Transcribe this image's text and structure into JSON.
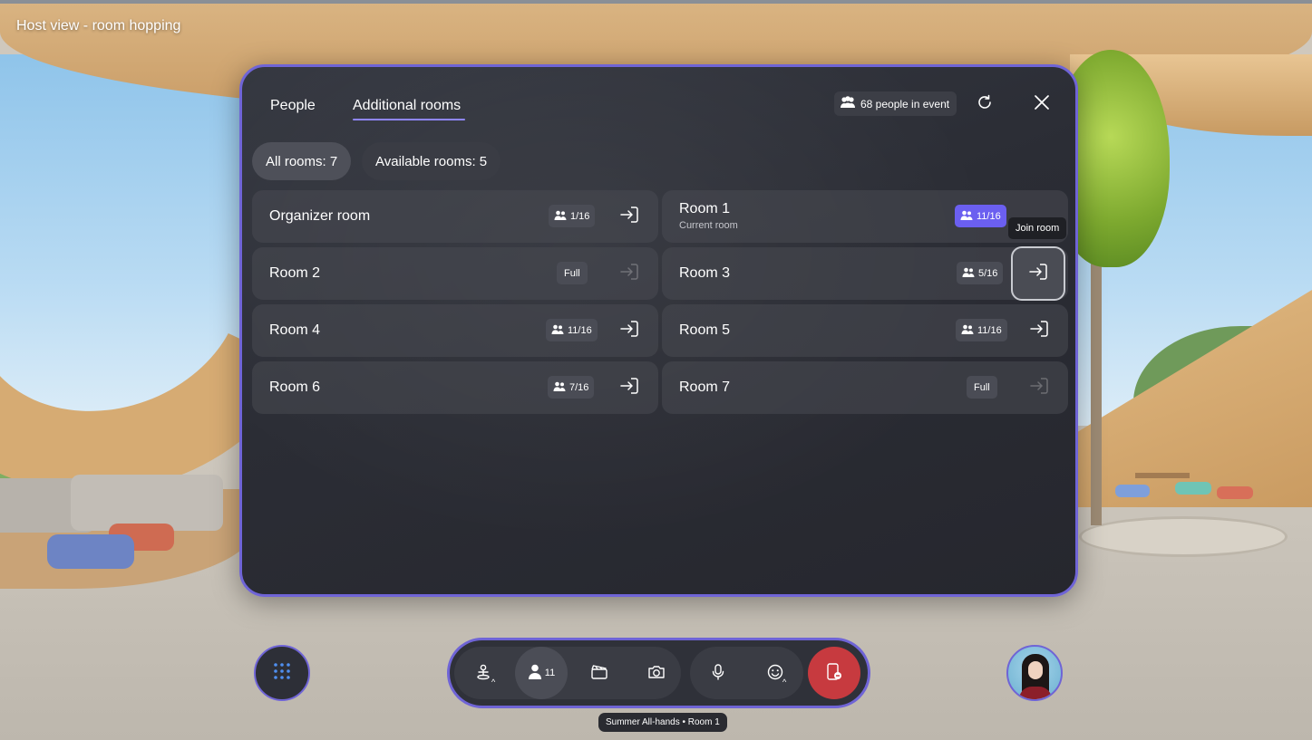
{
  "scene": {
    "title": "Host view - room hopping"
  },
  "panel": {
    "tabs": [
      {
        "label": "People"
      },
      {
        "label": "Additional rooms"
      }
    ],
    "people_in_event": "68 people in event",
    "filters": {
      "all": "All rooms: 7",
      "available": "Available rooms: 5"
    },
    "rooms": [
      {
        "name": "Organizer room",
        "subtitle": "",
        "count": "1/16",
        "state": "available"
      },
      {
        "name": "Room 1",
        "subtitle": "Current room",
        "count": "11/16",
        "state": "current"
      },
      {
        "name": "Room 2",
        "subtitle": "",
        "count": "Full",
        "state": "full"
      },
      {
        "name": "Room 3",
        "subtitle": "",
        "count": "5/16",
        "state": "available"
      },
      {
        "name": "Room 4",
        "subtitle": "",
        "count": "11/16",
        "state": "available"
      },
      {
        "name": "Room 5",
        "subtitle": "",
        "count": "11/16",
        "state": "available"
      },
      {
        "name": "Room 6",
        "subtitle": "",
        "count": "7/16",
        "state": "available"
      },
      {
        "name": "Room 7",
        "subtitle": "",
        "count": "Full",
        "state": "full"
      }
    ],
    "tooltip": "Join room"
  },
  "toolbar": {
    "participant_count": "11",
    "status": "Summer All-hands • Room 1"
  },
  "icons": {
    "people": "people-icon",
    "refresh": "refresh-icon",
    "close": "close-icon",
    "join": "join-room-icon",
    "apps": "apps-grid-icon",
    "avatar_stand": "avatar-stand-icon",
    "person": "person-icon",
    "clapper": "clapperboard-icon",
    "camera": "camera-icon",
    "mic": "microphone-icon",
    "emoji": "emoji-icon",
    "leave": "leave-icon"
  },
  "colors": {
    "accent": "#6f64d6",
    "current_room": "#6b5ff0",
    "leave": "#c73a3f"
  }
}
